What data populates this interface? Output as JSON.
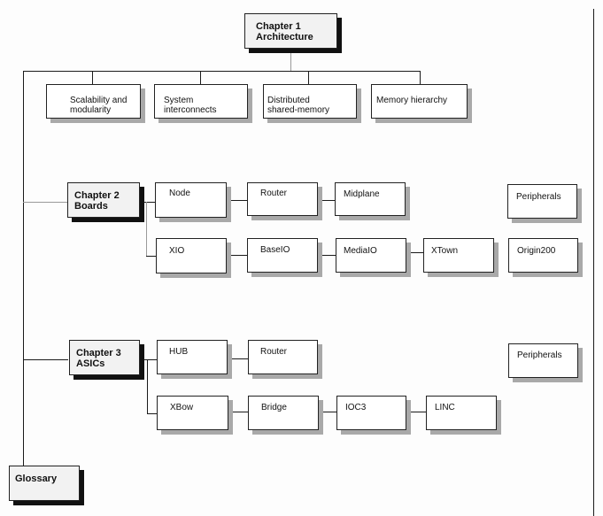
{
  "diagram": {
    "chapter1": {
      "label": "Chapter 1\nArchitecture",
      "children": [
        "Scalability and\nmodularity",
        "System\ninterconnects",
        "Distributed\nshared-memory",
        "Memory hierarchy"
      ]
    },
    "chapter2": {
      "label": "Chapter 2\nBoards",
      "row1": [
        "Node",
        "Router",
        "Midplane"
      ],
      "row2": [
        "XIO",
        "BaseIO",
        "MediaIO",
        "XTown"
      ],
      "side": [
        "Peripherals",
        "Origin200"
      ]
    },
    "chapter3": {
      "label": "Chapter 3\nASICs",
      "row1": [
        "HUB",
        "Router"
      ],
      "row2": [
        "XBow",
        "Bridge",
        "IOC3",
        "LINC"
      ],
      "side": [
        "Peripherals"
      ]
    },
    "glossary": {
      "label": "Glossary"
    }
  }
}
